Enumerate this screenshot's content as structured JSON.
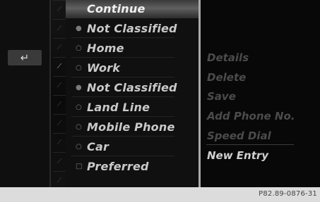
{
  "back_icon_glyph": "↵",
  "strip_marker": "⁄",
  "menu": {
    "items": [
      {
        "label": "Continue",
        "marker": "",
        "selected": true
      },
      {
        "label": "Not Classified",
        "marker": "●"
      },
      {
        "label": "Home",
        "marker": "○"
      },
      {
        "label": "Work",
        "marker": "○"
      },
      {
        "label": "Not Classified",
        "marker": "●"
      },
      {
        "label": "Land Line",
        "marker": "○"
      },
      {
        "label": "Mobile Phone",
        "marker": "○"
      },
      {
        "label": "Car",
        "marker": "○"
      },
      {
        "label": "Preferred",
        "marker": "□"
      }
    ]
  },
  "right_menu": {
    "items": [
      {
        "label": "Details",
        "enabled": false
      },
      {
        "label": "Delete",
        "enabled": false
      },
      {
        "label": "Save",
        "enabled": false
      },
      {
        "label": "Add Phone No.",
        "enabled": false
      },
      {
        "label": "Speed Dial",
        "enabled": false
      },
      {
        "label": "New Entry",
        "enabled": true
      }
    ]
  },
  "footer": {
    "code": "P82.89-0876-31"
  },
  "colors": {
    "highlight": "#606060",
    "menu_border": "#a9a9a9",
    "text": "#c9c9c9",
    "disabled": "#4b4b4b"
  }
}
